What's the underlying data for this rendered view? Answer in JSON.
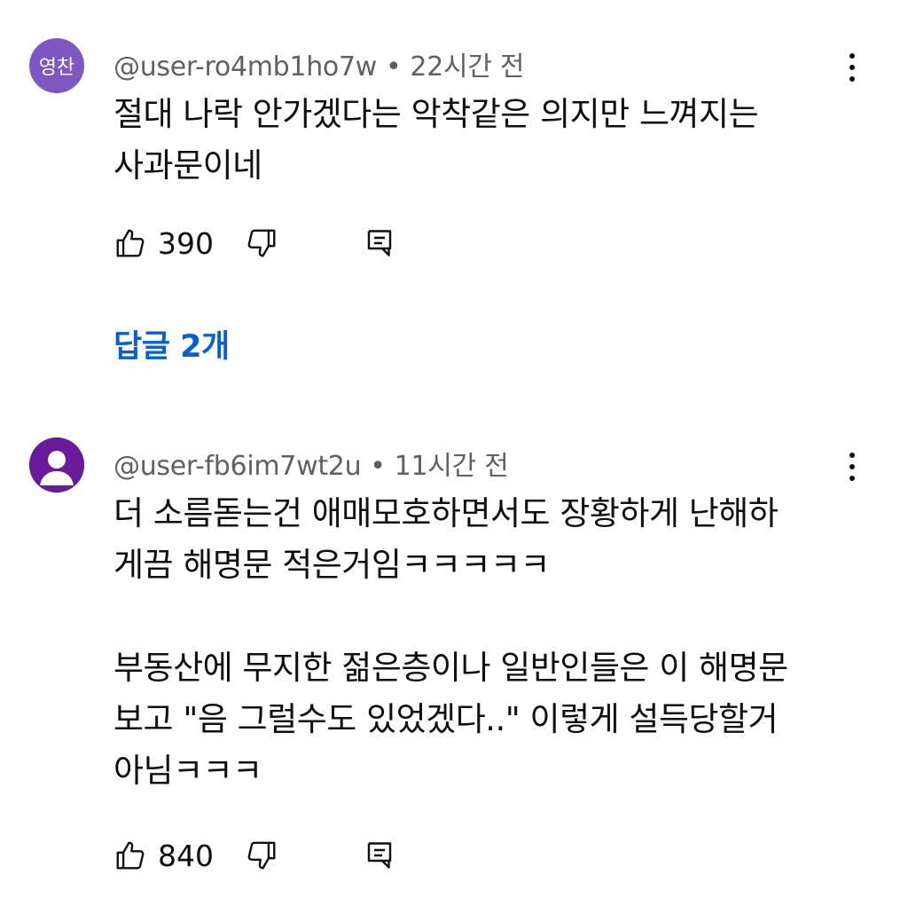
{
  "comments": [
    {
      "avatar": {
        "text": "영찬",
        "color": "#7e57c2",
        "icon": "avatar-initials"
      },
      "author": "@user-ro4mb1ho7w",
      "separator": "•",
      "time": "22시간 전",
      "lines": [
        "절대 나락 안가겠다는 악착같은 의지만 느껴지는",
        "사과문이네"
      ],
      "likes": "390",
      "replies_label": "답글 2개"
    },
    {
      "avatar": {
        "color": "#6a1b9a",
        "icon": "default-user-avatar-icon"
      },
      "author": "@user-fb6im7wt2u",
      "separator": "•",
      "time": "11시간 전",
      "lines": [
        "더 소름돋는건 애매모호하면서도 장황하게 난해하",
        "게끔 해명문 적은거임ㅋㅋㅋㅋㅋ",
        "",
        "부동산에 무지한 젊은층이나 일반인들은 이 해명문",
        "보고 \"음 그럴수도 있었겠다..\" 이렇게 설득당할거",
        "아님ㅋㅋㅋ"
      ],
      "likes": "840"
    }
  ],
  "colors": {
    "link_blue": "#065fd4",
    "text_primary": "#0f0f0f",
    "text_secondary": "#606060"
  },
  "icons": [
    "thumbs-up-icon",
    "thumbs-down-icon",
    "reply-icon",
    "more-vert-icon"
  ]
}
